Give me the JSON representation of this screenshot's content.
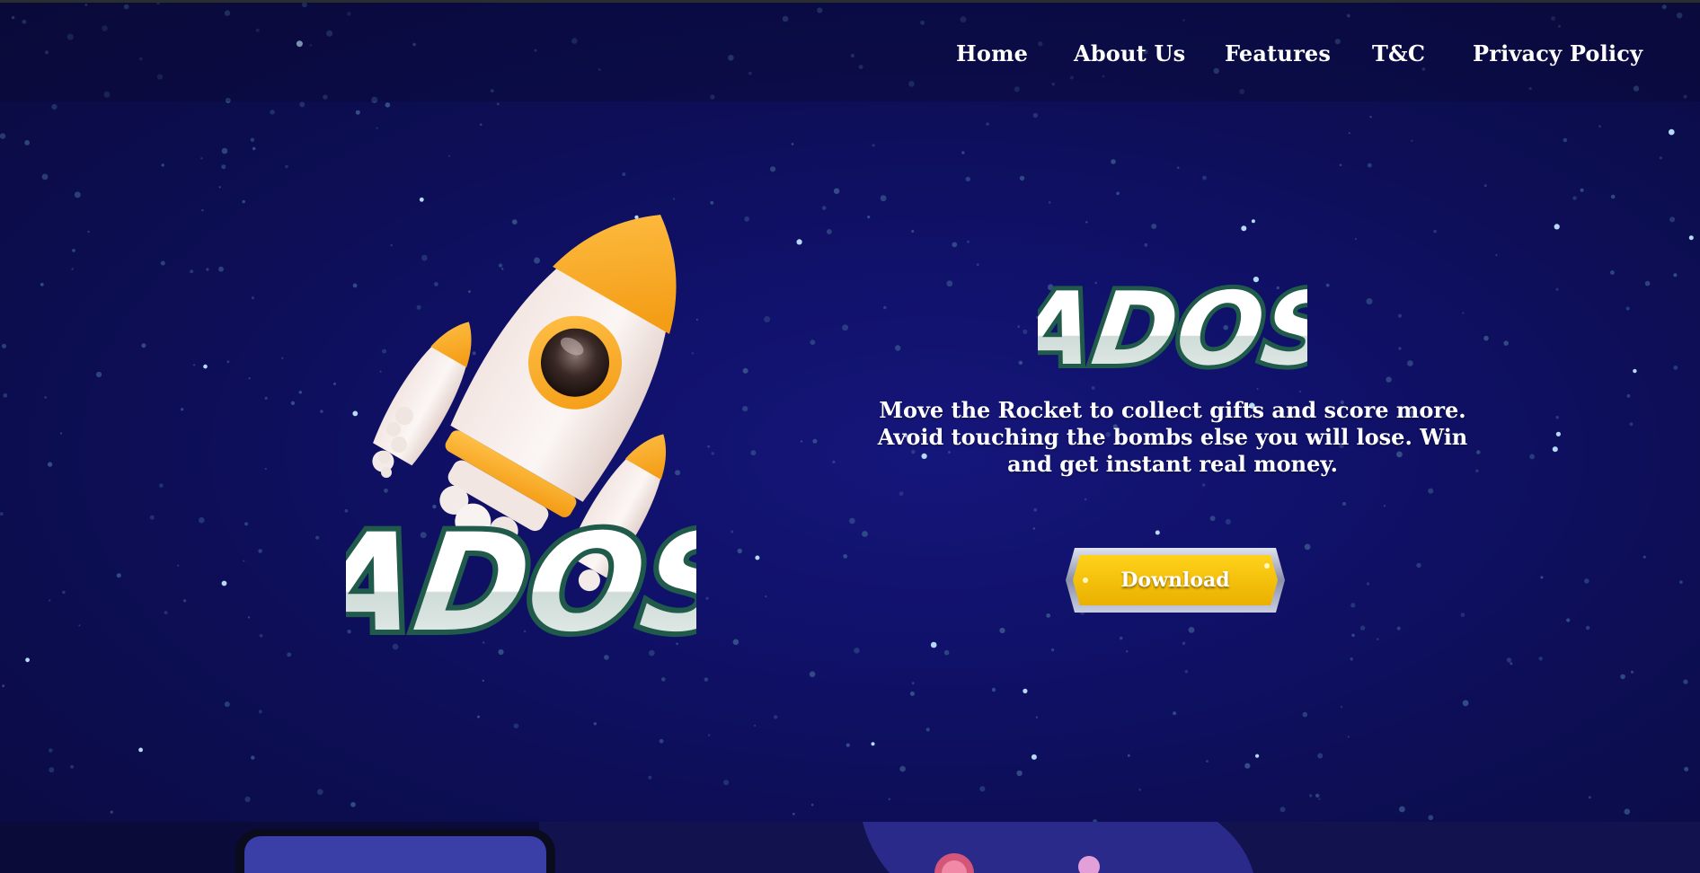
{
  "nav": {
    "items": [
      {
        "label": "Home"
      },
      {
        "label": "About Us"
      },
      {
        "label": "Features"
      },
      {
        "label": "T&C"
      },
      {
        "label": "Privacy Policy"
      }
    ]
  },
  "hero": {
    "logo_text": "ADOS",
    "tagline_lines": [
      "Move the Rocket to collect gifts and score more.",
      "Avoid touching the bombs else you will lose. Win",
      "and get instant real money."
    ],
    "download_label": "Download"
  },
  "colors": {
    "background": "#0c0c45",
    "accent_yellow": "#f2bf00",
    "logo_outline": "#1f5a4a",
    "rocket_orange": "#f5a623"
  },
  "icons": {
    "rocket": "rocket-illustration",
    "phone": "phone-mockup"
  }
}
